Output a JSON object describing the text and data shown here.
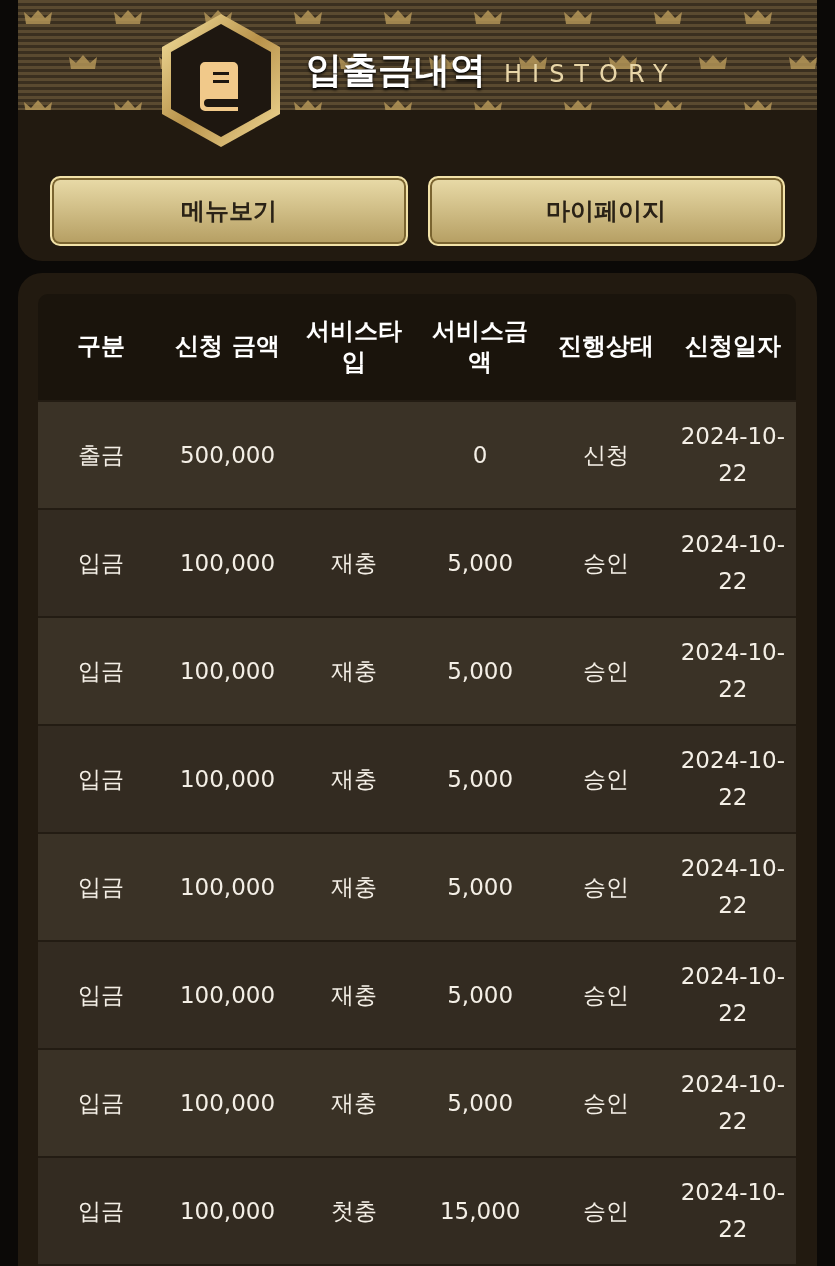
{
  "header": {
    "title": "입출금내역",
    "subtitle": "HISTORY"
  },
  "buttons": [
    "메뉴보기",
    "마이페이지"
  ],
  "table": {
    "columns": [
      "구분",
      "신청 금액",
      "서비스타입",
      "서비스금액",
      "진행상태",
      "신청일자"
    ],
    "rows": [
      {
        "type": "출금",
        "amount": "500,000",
        "service_amount": "0",
        "status": "신청",
        "date": "2024-10-22"
      },
      {
        "type": "입금",
        "amount": "100,000",
        "service_type": "재충",
        "service_amount": "5,000",
        "status": "승인",
        "date": "2024-10-22"
      },
      {
        "type": "입금",
        "amount": "100,000",
        "service_type": "재충",
        "service_amount": "5,000",
        "status": "승인",
        "date": "2024-10-22"
      },
      {
        "type": "입금",
        "amount": "100,000",
        "service_type": "재충",
        "service_amount": "5,000",
        "status": "승인",
        "date": "2024-10-22"
      },
      {
        "type": "입금",
        "amount": "100,000",
        "service_type": "재충",
        "service_amount": "5,000",
        "status": "승인",
        "date": "2024-10-22"
      },
      {
        "type": "입금",
        "amount": "100,000",
        "service_type": "재충",
        "service_amount": "5,000",
        "status": "승인",
        "date": "2024-10-22"
      },
      {
        "type": "입금",
        "amount": "100,000",
        "service_type": "재충",
        "service_amount": "5,000",
        "status": "승인",
        "date": "2024-10-22"
      },
      {
        "type": "입금",
        "amount": "100,000",
        "service_type": "첫충",
        "service_amount": "15,000",
        "status": "승인",
        "date": "2024-10-22"
      }
    ]
  }
}
